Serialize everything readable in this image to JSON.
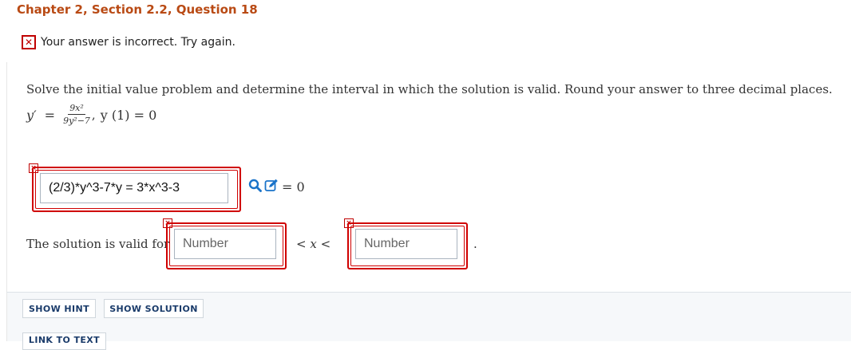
{
  "header": {
    "title": "Chapter 2, Section 2.2, Question 18"
  },
  "alert": {
    "message": "Your answer is incorrect.  Try again."
  },
  "question": {
    "prompt": "Solve the initial value problem and determine the interval in which the solution is valid. Round your answer to three decimal places.",
    "equation": {
      "lhs": "y′",
      "equals": "=",
      "numerator": "9x²",
      "denominator": "9y²−7",
      "comma": ",",
      "initial_condition": "y (1) = 0"
    }
  },
  "answer": {
    "solution_value": "(2/3)*y^3-7*y = 3*x^3-3",
    "equals_zero": "= 0",
    "valid_label": "The solution is valid for",
    "lower_placeholder": "Number",
    "inequality": "< x <",
    "upper_placeholder": "Number",
    "period": "."
  },
  "buttons": {
    "show_hint": "SHOW HINT",
    "show_solution": "SHOW SOLUTION",
    "link_to_text": "LINK TO TEXT"
  },
  "colors": {
    "title": "#b94a14",
    "error": "#d00000",
    "button_text": "#1a3b6a",
    "tool_icon": "#1a73c9"
  },
  "icons": {
    "incorrect": "x-mark-icon",
    "field_error": "small-x-icon",
    "search": "magnifier-icon",
    "edit": "pencil-square-icon"
  }
}
